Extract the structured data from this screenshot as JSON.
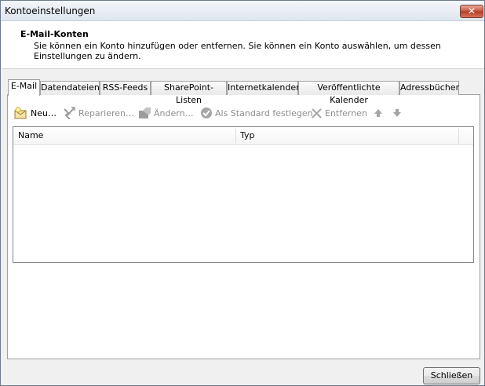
{
  "window": {
    "title": "Kontoeinstellungen",
    "close_glyph": "✕"
  },
  "header": {
    "title": "E-Mail-Konten",
    "description": "Sie können ein Konto hinzufügen oder entfernen. Sie können ein Konto auswählen, um dessen Einstellungen zu ändern."
  },
  "tabs": [
    {
      "label": "E-Mail",
      "active": true
    },
    {
      "label": "Datendateien"
    },
    {
      "label": "RSS-Feeds"
    },
    {
      "label": "SharePoint-Listen"
    },
    {
      "label": "Internetkalender"
    },
    {
      "label": "Veröffentlichte Kalender"
    },
    {
      "label": "Adressbücher"
    }
  ],
  "toolbar": {
    "new": {
      "label": "Neu…",
      "icon": "new-account-icon",
      "enabled": true
    },
    "repair": {
      "label": "Reparieren…",
      "icon": "repair-tools-icon",
      "enabled": false
    },
    "change": {
      "label": "Ändern…",
      "icon": "change-icon",
      "enabled": false
    },
    "default": {
      "label": "Als Standard festlegen",
      "icon": "checkmark-circle-icon",
      "enabled": false
    },
    "remove": {
      "label": "Entfernen",
      "icon": "remove-x-icon",
      "enabled": false
    },
    "up_icon": "arrow-up-icon",
    "down_icon": "arrow-down-icon"
  },
  "list": {
    "columns": [
      "Name",
      "Typ"
    ],
    "rows": []
  },
  "footer": {
    "close_label": "Schließen"
  }
}
